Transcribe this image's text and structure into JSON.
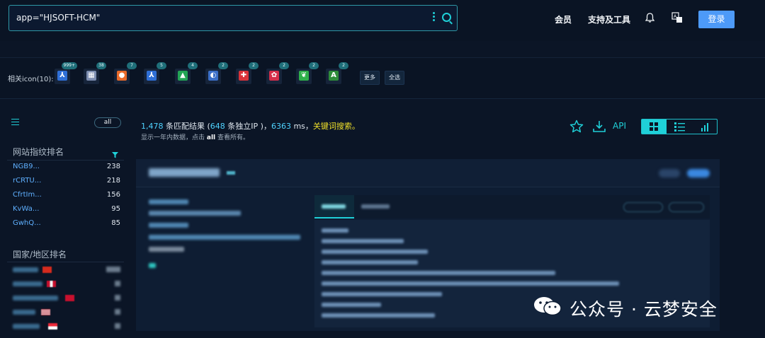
{
  "header": {
    "search_value": "app=\"HJSOFT-HCM\"",
    "nav": [
      "会员",
      "支持及工具"
    ],
    "login_label": "登录"
  },
  "icon_row": {
    "label": "相关icon(10):",
    "icons": [
      {
        "name": "arrow-logo-icon",
        "count": "999+",
        "color": "#2f6fd6",
        "glyph": "⅄"
      },
      {
        "name": "grid-logo-icon",
        "count": "38",
        "color": "#7c8db0",
        "glyph": "▦"
      },
      {
        "name": "firefox-icon",
        "count": "7",
        "color": "#e86a2a",
        "glyph": "●"
      },
      {
        "name": "arrow-logo-icon-2",
        "count": "5",
        "color": "#2f6fd6",
        "glyph": "⅄"
      },
      {
        "name": "green-tree-icon",
        "count": "4",
        "color": "#23a455",
        "glyph": "▲"
      },
      {
        "name": "blue-circle-icon",
        "count": "2",
        "color": "#3b6fc8",
        "glyph": "◐"
      },
      {
        "name": "red-bird-icon",
        "count": "2",
        "color": "#d9333a",
        "glyph": "✚"
      },
      {
        "name": "red-dots-icon",
        "count": "2",
        "color": "#d62e4a",
        "glyph": "✿"
      },
      {
        "name": "green-leaf-icon",
        "count": "2",
        "color": "#2fb04a",
        "glyph": "❦"
      },
      {
        "name": "green-a-icon",
        "count": "2",
        "color": "#2f8d3a",
        "glyph": "A"
      }
    ],
    "more_label": "更多",
    "select_all_label": "全选"
  },
  "left": {
    "all_label": "all",
    "fingerprint_title": "网站指纹排名",
    "fingerprints": [
      {
        "name": "NGB9...",
        "value": "238"
      },
      {
        "name": "rCRTU...",
        "value": "218"
      },
      {
        "name": "CfrtIm...",
        "value": "156"
      },
      {
        "name": "KvWa...",
        "value": "95"
      },
      {
        "name": "GwhQ...",
        "value": "85"
      }
    ],
    "country_title": "国家/地区排名"
  },
  "results": {
    "count": "1,478",
    "count_suffix": " 条匹配结果 (",
    "ip_count": "648",
    "ip_suffix": " 条独立IP )，",
    "ms": "6363",
    "ms_suffix": " ms，",
    "keyword_link": "关键词搜索。",
    "sub_prefix": "显示一年内数据，点击 ",
    "sub_all": "all",
    "sub_suffix": " 查看所有。",
    "api_label": "API"
  },
  "watermark": "公众号 · 云梦安全",
  "colors": {
    "accent": "#1fd0d8",
    "login": "#4d9af8",
    "keyword": "#f0e02a",
    "link": "#5fb0ff"
  }
}
